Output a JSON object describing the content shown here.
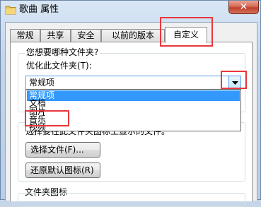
{
  "window": {
    "title": "歌曲 属性",
    "close_label": "✕",
    "accent_highlight": "#e8383d"
  },
  "tabs": [
    {
      "label": "常规"
    },
    {
      "label": "共享"
    },
    {
      "label": "安全"
    },
    {
      "label": "以前的版本"
    },
    {
      "label": "自定义",
      "active": true
    }
  ],
  "folder_type_section": {
    "question": "您想要哪种文件夹?",
    "optimize_label": "优化此文件夹(T):",
    "selected_value": "常规项",
    "options": [
      {
        "label": "常规项",
        "selected": true
      },
      {
        "label": "文档"
      },
      {
        "label": "图片"
      },
      {
        "label": "音乐"
      },
      {
        "label": "视频"
      }
    ]
  },
  "folder_picture_section": {
    "partial_label": "选择要在此文件夹图标上显示的文件。",
    "choose_file_button": "选择文件(F)...",
    "restore_default_button": "还原默认图标(R)"
  },
  "folder_icon_section": {
    "label": "文件夹图标"
  }
}
